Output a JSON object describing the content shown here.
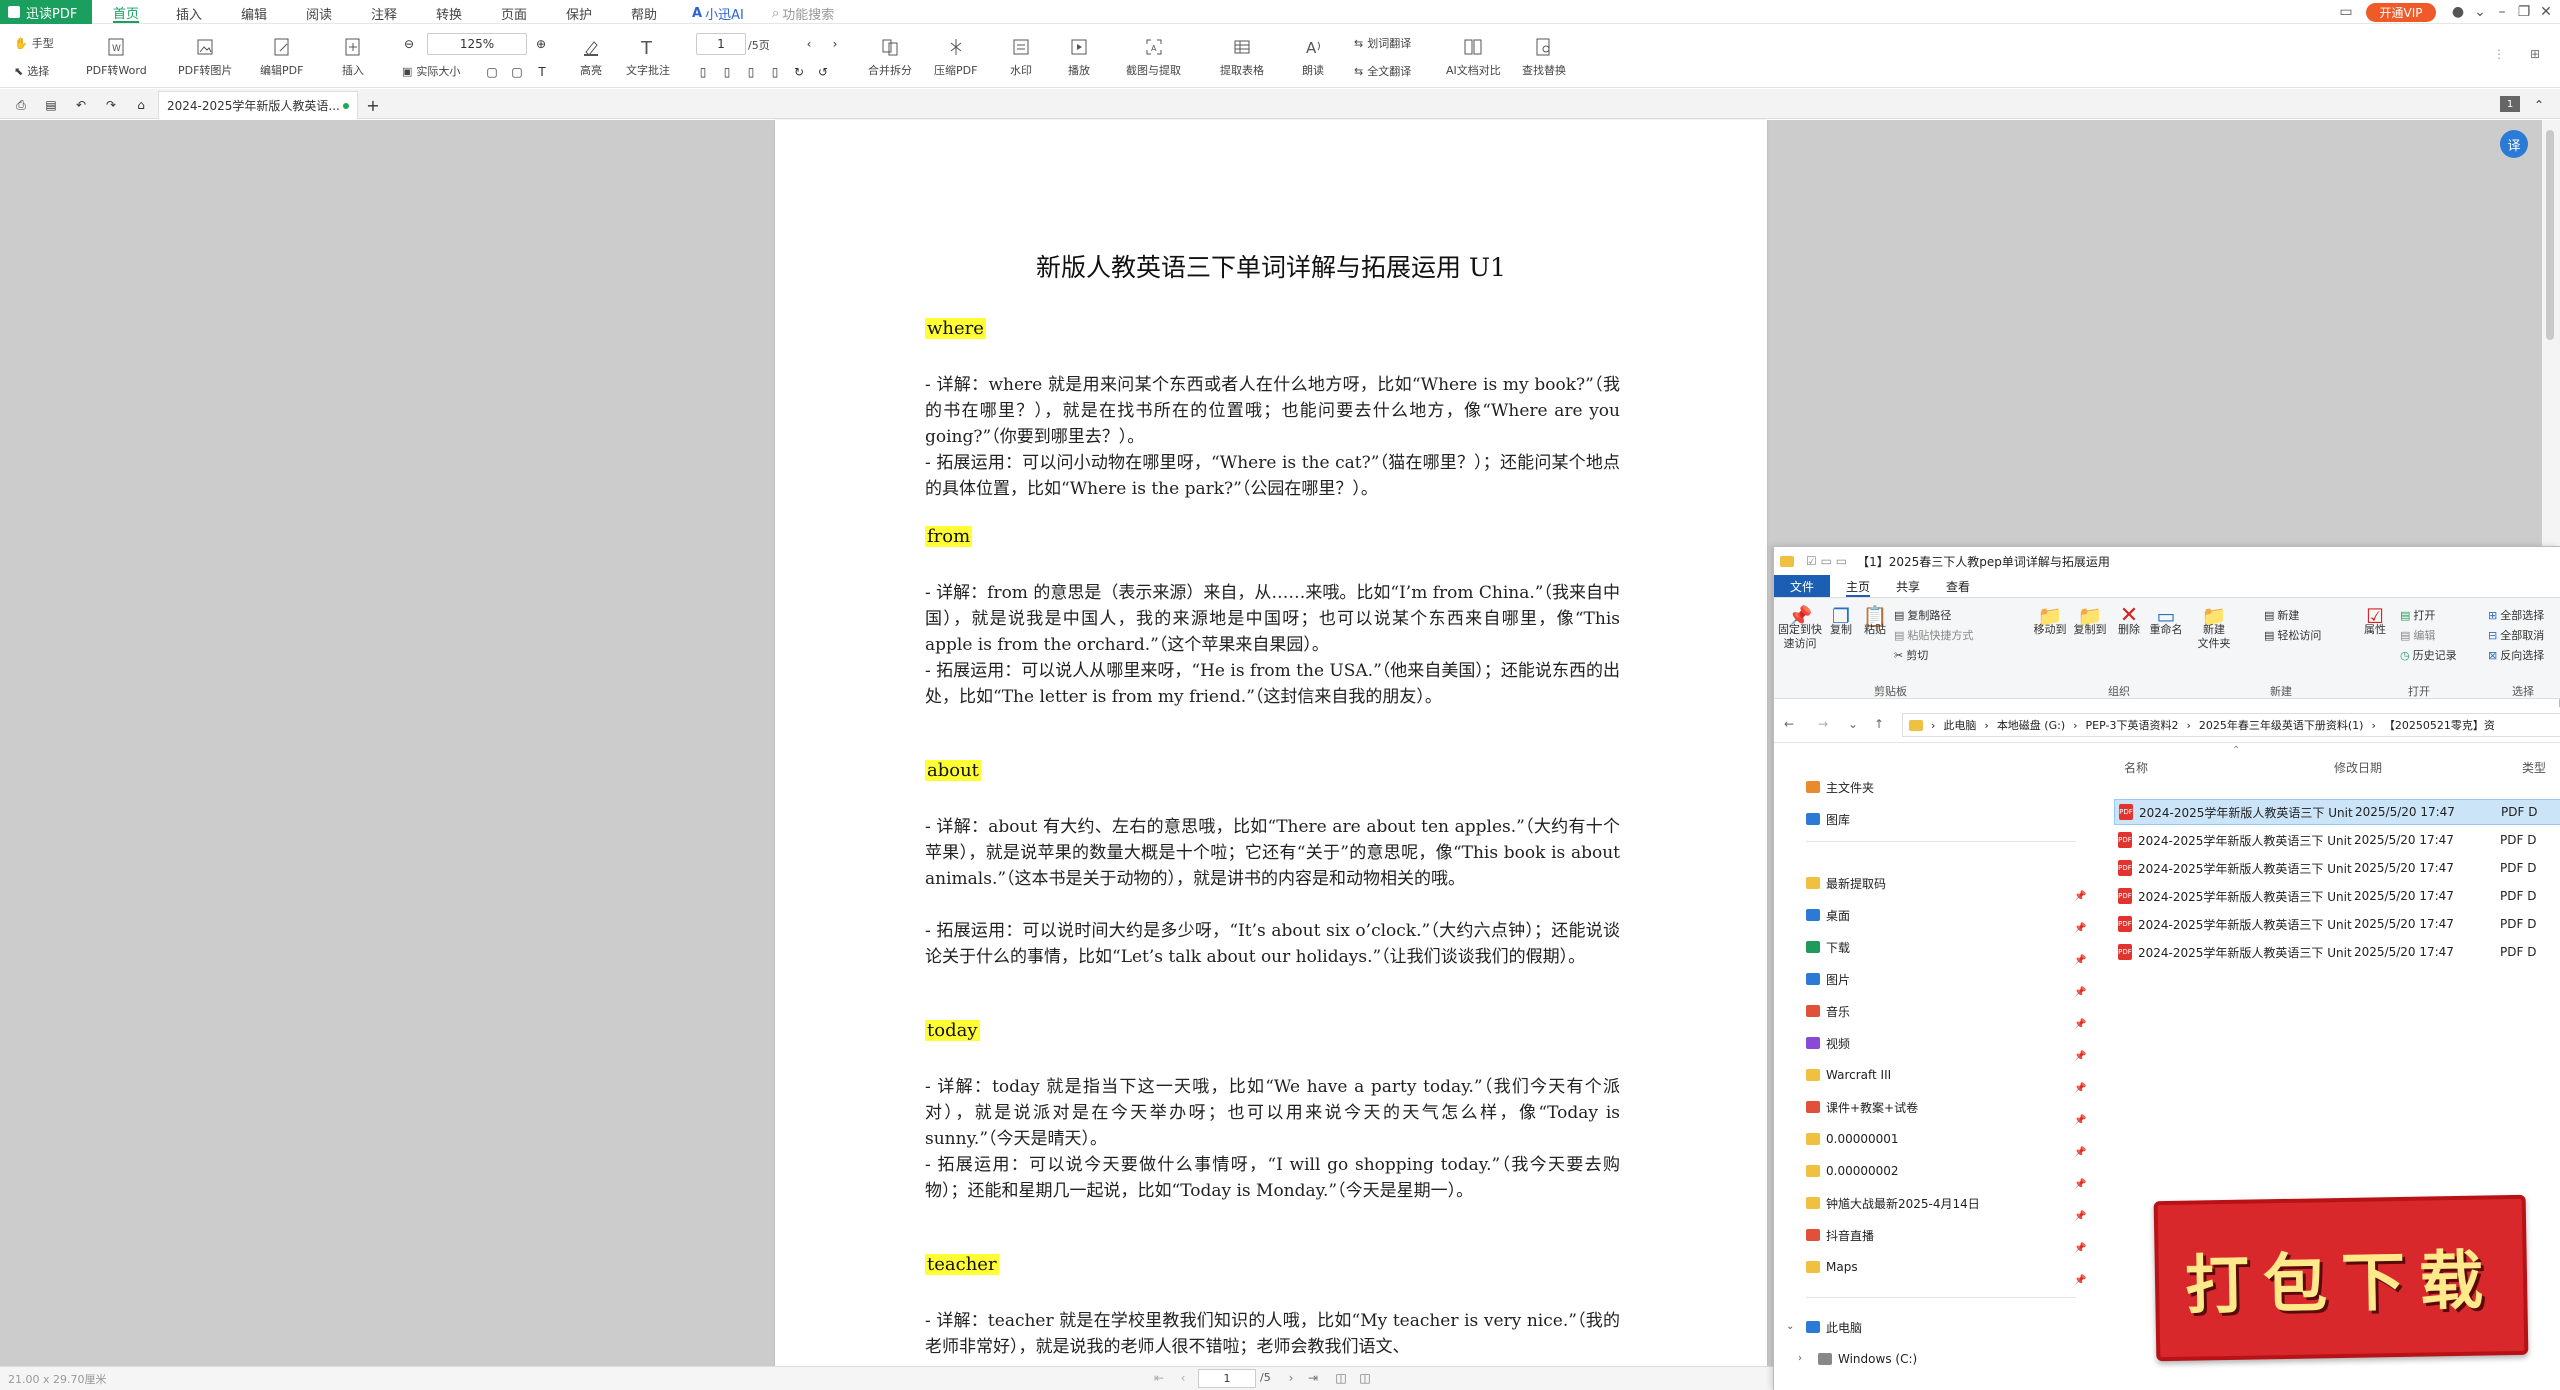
{
  "app": {
    "name": "迅读PDF",
    "menu_tabs": [
      "首页",
      "插入",
      "编辑",
      "阅读",
      "注释",
      "转换",
      "页面",
      "保护",
      "帮助",
      "小迅AI",
      "功能搜索"
    ],
    "vip_label": "开通VIP",
    "accent_color": "#1a9f5f"
  },
  "toolbar": {
    "hand": "手型",
    "select": "选择",
    "pdf_to_word": "PDF转Word",
    "pdf_to_image": "PDF转图片",
    "edit_pdf": "编辑PDF",
    "insert": "插入",
    "zoom": "125%",
    "actual_size": "实际大小",
    "highlight": "高亮",
    "text_note": "文字批注",
    "page_input": "1",
    "page_total": "/5页",
    "merge_split": "合并拆分",
    "compress": "压缩PDF",
    "watermark": "水印",
    "play": "播放",
    "screenshot": "截图与提取",
    "extract_table": "提取表格",
    "read_aloud": "朗读",
    "word_translate": "划词翻译",
    "full_translate": "全文翻译",
    "ai_compare": "AI文档对比",
    "find_replace": "查找替换"
  },
  "tabs": {
    "doc_tab": "2024-2025学年新版人教英语...",
    "page_badge": "1"
  },
  "document": {
    "title": "新版人教英语三下单词详解与拓展运用 U1",
    "entries": [
      {
        "word": "where",
        "detail": "- 详解：where 就是用来问某个东西或者人在什么地方呀，比如“Where is my book?”（我的书在哪里？），就是在找书所在的位置哦；也能问要去什么地方，像“Where are you going?”（你要到哪里去？）。",
        "usage": "- 拓展运用：可以问小动物在哪里呀，“Where is the cat?”（猫在哪里？）；还能问某个地点的具体位置，比如“Where is the park?”（公园在哪里？）。"
      },
      {
        "word": "from",
        "detail": "- 详解：from 的意思是（表示来源）来自，从……来哦。比如“I’m from China.”（我来自中国），就是说我是中国人，我的来源地是中国呀；也可以说某个东西来自哪里，像“This apple is from the orchard.”（这个苹果来自果园）。",
        "usage": "- 拓展运用：可以说人从哪里来呀，“He is from the USA.”（他来自美国）；还能说东西的出处，比如“The letter is from my friend.”（这封信来自我的朋友）。"
      },
      {
        "word": "about",
        "detail": "- 详解：about 有大约、左右的意思哦，比如“There are about ten apples.”（大约有十个苹果），就是说苹果的数量大概是十个啦；它还有“关于”的意思呢，像“This book is about animals.”（这本书是关于动物的），就是讲书的内容是和动物相关的哦。",
        "usage": "- 拓展运用：可以说时间大约是多少呀，“It’s about six o’clock.”（大约六点钟）；还能说谈论关于什么的事情，比如“Let’s talk about our holidays.”（让我们谈谈我们的假期）。"
      },
      {
        "word": "today",
        "detail": "- 详解：today 就是指当下这一天哦，比如“We have a party today.”（我们今天有个派对），就是说派对是在今天举办呀；也可以用来说今天的天气怎么样，像“Today is sunny.”（今天是晴天）。",
        "usage": "- 拓展运用：可以说今天要做什么事情呀，“I will go shopping today.”（我今天要去购物）；还能和星期几一起说，比如“Today is Monday.”（今天是星期一）。"
      },
      {
        "word": "teacher",
        "detail": "- 详解：teacher 就是在学校里教我们知识的人哦，比如“My teacher is very nice.”（我的老师非常好），就是说我的老师人很不错啦；老师会教我们语文、",
        "usage": ""
      }
    ]
  },
  "status": {
    "page_size": "21.00 x 29.70厘米",
    "current_page": "1",
    "total_pages": "/5"
  },
  "explorer": {
    "title": "【1】2025春三下人教pep单词详解与拓展运用",
    "ribbon_tabs": [
      "文件",
      "主页",
      "共享",
      "查看"
    ],
    "ribbon": {
      "pin": "固定到快\n速访问",
      "copy": "复制",
      "paste": "粘贴",
      "copy_path": "复制路径",
      "paste_shortcut": "粘贴快捷方式",
      "cut": "剪切",
      "move_to": "移动到",
      "copy_to": "复制到",
      "delete": "删除",
      "rename": "重命名",
      "new_folder": "新建\n文件夹",
      "new": "新建",
      "easy_access": "轻松访问",
      "properties": "属性",
      "open": "打开",
      "edit": "编辑",
      "history": "历史记录",
      "select_all": "全部选择",
      "select_none": "全部取消",
      "invert": "反向选择",
      "groups": [
        "剪贴板",
        "组织",
        "新建",
        "打开",
        "选择"
      ]
    },
    "breadcrumb": [
      "此电脑",
      "本地磁盘 (G:)",
      "PEP-3下英语资料2",
      "2025年春三年级英语下册资料(1)",
      "【20250521零克】资"
    ],
    "nav": [
      {
        "label": "主文件夹",
        "color": "#e98b2a"
      },
      {
        "label": "图库",
        "color": "#2b7bd6"
      },
      {
        "label": "最新提取码",
        "color": "#f0c040"
      },
      {
        "label": "桌面",
        "color": "#2b7bd6"
      },
      {
        "label": "下载",
        "color": "#1e9a5a"
      },
      {
        "label": "图片",
        "color": "#2b7bd6"
      },
      {
        "label": "音乐",
        "color": "#e0503a"
      },
      {
        "label": "视频",
        "color": "#8a4ad6"
      },
      {
        "label": "Warcraft III",
        "color": "#f0c040"
      },
      {
        "label": "课件+教案+试卷",
        "color": "#e0503a"
      },
      {
        "label": "0.00000001",
        "color": "#f0c040"
      },
      {
        "label": "0.00000002",
        "color": "#f0c040"
      },
      {
        "label": "钟馗大战最新2025-4月14日",
        "color": "#f0c040"
      },
      {
        "label": "抖音直播",
        "color": "#e0503a"
      },
      {
        "label": "Maps",
        "color": "#f0c040"
      },
      {
        "label": "此电脑",
        "color": "#2b7bd6"
      },
      {
        "label": "Windows (C:)",
        "color": "#888888"
      }
    ],
    "columns": [
      "名称",
      "修改日期",
      "类型"
    ],
    "files": [
      {
        "name": "2024-2025学年新版人教英语三下 Unit ...",
        "date": "2025/5/20 17:47",
        "type": "PDF D"
      },
      {
        "name": "2024-2025学年新版人教英语三下 Unit ...",
        "date": "2025/5/20 17:47",
        "type": "PDF D"
      },
      {
        "name": "2024-2025学年新版人教英语三下 Unit ...",
        "date": "2025/5/20 17:47",
        "type": "PDF D"
      },
      {
        "name": "2024-2025学年新版人教英语三下 Unit ...",
        "date": "2025/5/20 17:47",
        "type": "PDF D"
      },
      {
        "name": "2024-2025学年新版人教英语三下 Unit ...",
        "date": "2025/5/20 17:47",
        "type": "PDF D"
      },
      {
        "name": "2024-2025学年新版人教英语三下 Unit ...",
        "date": "2025/5/20 17:47",
        "type": "PDF D"
      }
    ]
  },
  "banner": {
    "label": "打包下载"
  }
}
